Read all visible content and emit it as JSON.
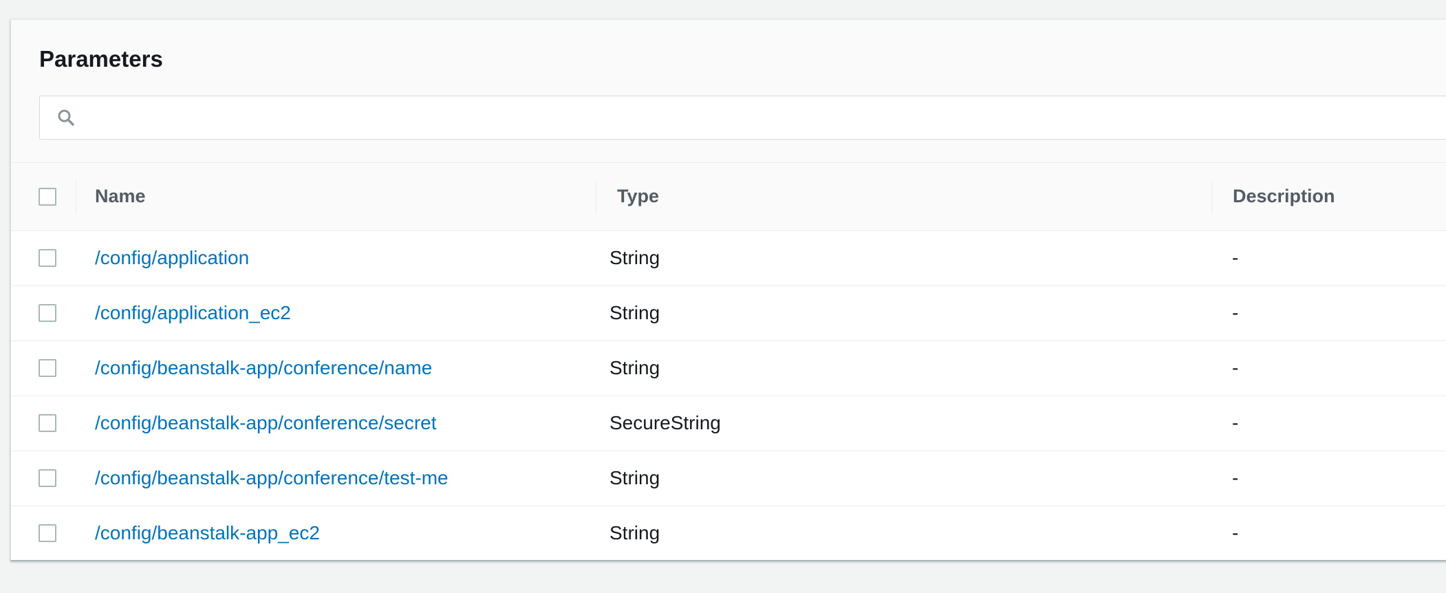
{
  "panel": {
    "title": "Parameters",
    "search": {
      "value": "",
      "placeholder": ""
    }
  },
  "table": {
    "columns": {
      "name": "Name",
      "type": "Type",
      "description": "Description"
    },
    "rows": [
      {
        "name": "/config/application",
        "type": "String",
        "description": "-"
      },
      {
        "name": "/config/application_ec2",
        "type": "String",
        "description": "-"
      },
      {
        "name": "/config/beanstalk-app/conference/name",
        "type": "String",
        "description": "-"
      },
      {
        "name": "/config/beanstalk-app/conference/secret",
        "type": "SecureString",
        "description": "-"
      },
      {
        "name": "/config/beanstalk-app/conference/test-me",
        "type": "String",
        "description": "-"
      },
      {
        "name": "/config/beanstalk-app_ec2",
        "type": "String",
        "description": "-"
      }
    ]
  },
  "icons": {
    "search": "search-icon"
  },
  "colors": {
    "link": "#0073bb",
    "header_text": "#545b64",
    "border": "#eaeded",
    "background": "#f2f3f3"
  }
}
